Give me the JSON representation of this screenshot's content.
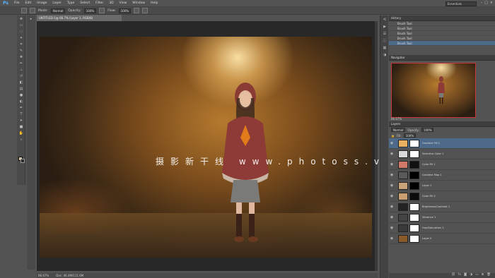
{
  "app": {
    "logo": "Ps",
    "workspace": "Essentials"
  },
  "menu": [
    "File",
    "Edit",
    "Image",
    "Layer",
    "Type",
    "Select",
    "Filter",
    "3D",
    "View",
    "Window",
    "Help"
  ],
  "window_buttons": [
    "–",
    "□",
    "×"
  ],
  "options": {
    "mode_label": "Mode:",
    "mode_value": "Normal",
    "opacity_label": "Opacity:",
    "opacity_value": "100%",
    "flow_label": "Flow:",
    "flow_value": "100%"
  },
  "document": {
    "tab_title": "UNTITLED-1@ 66.7% (Layer 1, RGB/8)",
    "zoom": "66.67%",
    "doc_size": "Doc: 46.4M/111.6M"
  },
  "watermark": "摄影新干线 www.photoss.vip",
  "panels": {
    "history_title": "History",
    "history_items": [
      "Brush Tool",
      "Brush Tool",
      "Brush Tool",
      "Brush Tool",
      "Brush Tool"
    ],
    "navigator_title": "Navigator",
    "navigator_zoom": "66.67%",
    "layers_title": "Layers",
    "blend_mode": "Normal",
    "opacity_label": "Opacity:",
    "opacity_value": "100%",
    "fill_label": "Fill:",
    "fill_value": "100%",
    "layers": [
      {
        "name": "Gradient Fill 1",
        "thumb": "#e8b060",
        "mask": "#ffffff"
      },
      {
        "name": "Selective Color 1",
        "thumb": "#d9d9d9",
        "mask": "#ffffff"
      },
      {
        "name": "Color Fill 1",
        "thumb": "#d27a6a",
        "mask": "#111111"
      },
      {
        "name": "Gradient Map 1",
        "thumb": "#5a5a5a",
        "mask": "#000000"
      },
      {
        "name": "Layer 1",
        "thumb": "#c9a37a",
        "mask": "#000000"
      },
      {
        "name": "Color Fill 2",
        "thumb": "#c99e70",
        "mask": "#0b0b0b"
      },
      {
        "name": "Brightness/Contrast 1",
        "thumb": "#222222",
        "mask": "#ffffff"
      },
      {
        "name": "Vibrance 1",
        "thumb": "#444444",
        "mask": "#ffffff"
      },
      {
        "name": "Hue/Saturation 1",
        "thumb": "#3a3a3a",
        "mask": "#ffffff"
      },
      {
        "name": "Layer 0",
        "thumb": "#8a5a2a",
        "mask": "#ffffff"
      }
    ],
    "footer_icons": [
      "link-icon",
      "fx-icon",
      "mask-icon",
      "adjustment-icon",
      "folder-icon",
      "new-layer-icon",
      "trash-icon"
    ]
  },
  "colors": {
    "accent": "#4d6a8a",
    "panel": "#535353",
    "dark": "#282828"
  }
}
